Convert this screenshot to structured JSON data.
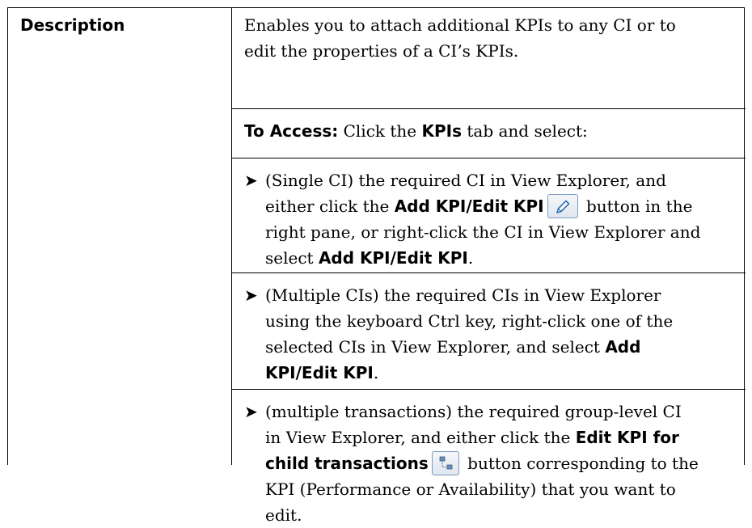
{
  "table": {
    "label": "Description",
    "intro": [
      "Enables you to attach additional KPIs to any CI or to",
      "edit the properties of a CI’s KPIs."
    ],
    "access": {
      "lead": "To Access:",
      "text1": " Click the ",
      "tab": "KPIs",
      "text2": " tab and select:"
    },
    "bullet_glyph": "➤",
    "bullet1": {
      "l1": "(Single CI) the required CI in View Explorer, and",
      "l2_a": "either click the ",
      "l2_b": "Add KPI/Edit KPI",
      "l2_c": " button in the",
      "l3": "right pane, or right-click the CI in View Explorer and",
      "l4_a": "select ",
      "l4_b": "Add KPI/Edit KPI",
      "l4_c": "."
    },
    "bullet2": {
      "l1": "(Multiple CIs) the required CIs in View Explorer",
      "l2": "using the keyboard Ctrl key, right-click one of the",
      "l3_a": "selected CIs in View Explorer, and select ",
      "l3_b": "Add",
      "l4_a": "KPI/Edit KPI",
      "l4_b": "."
    },
    "bullet3": {
      "l1": "(multiple transactions) the required group-level CI",
      "l2_a": "in View Explorer, and either click the ",
      "l2_b": "Edit KPI for",
      "l3_a": "child transactions",
      "l3_b": " button corresponding to the",
      "l4": "KPI (Performance or Availability) that you want to",
      "l5": "edit."
    }
  },
  "icons": {
    "edit": "pencil-icon",
    "child": "child-transactions-icon"
  }
}
